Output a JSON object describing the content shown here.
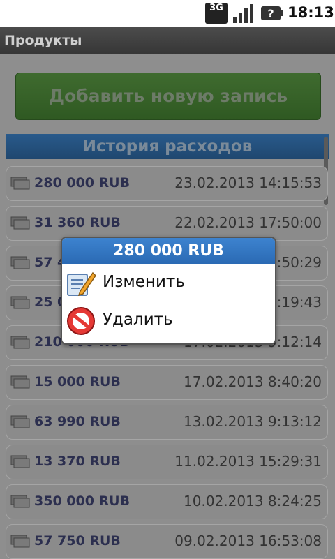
{
  "status_bar": {
    "network": "3G",
    "time": "18:13",
    "icons": [
      "3g-data-icon",
      "signal-icon",
      "battery-unknown-icon"
    ]
  },
  "app": {
    "title": "Продукты"
  },
  "main": {
    "add_button_label": "Добавить новую запись",
    "history_header": "История расходов",
    "entries": [
      {
        "amount": "280 000 RUB",
        "date": "23.02.2013 14:15:53"
      },
      {
        "amount": "31 360 RUB",
        "date": "22.02.2013 17:50:00"
      },
      {
        "amount": "57 4",
        "date": "6:50:29"
      },
      {
        "amount": "25 0",
        "date": "6:19:43"
      },
      {
        "amount": "210 000 RUB",
        "date": "17.02.2013 9:12:14"
      },
      {
        "amount": "15 000 RUB",
        "date": "17.02.2013 8:40:20"
      },
      {
        "amount": "63 990 RUB",
        "date": "13.02.2013 9:13:12"
      },
      {
        "amount": "13 370 RUB",
        "date": "11.02.2013 15:29:31"
      },
      {
        "amount": "350 000 RUB",
        "date": "10.02.2013 8:24:25"
      },
      {
        "amount": "57 750 RUB",
        "date": "09.02.2013 16:53:08"
      }
    ]
  },
  "dialog": {
    "title": "280 000 RUB",
    "items": [
      {
        "label": "Изменить",
        "icon": "edit-icon"
      },
      {
        "label": "Удалить",
        "icon": "delete-icon"
      }
    ]
  }
}
